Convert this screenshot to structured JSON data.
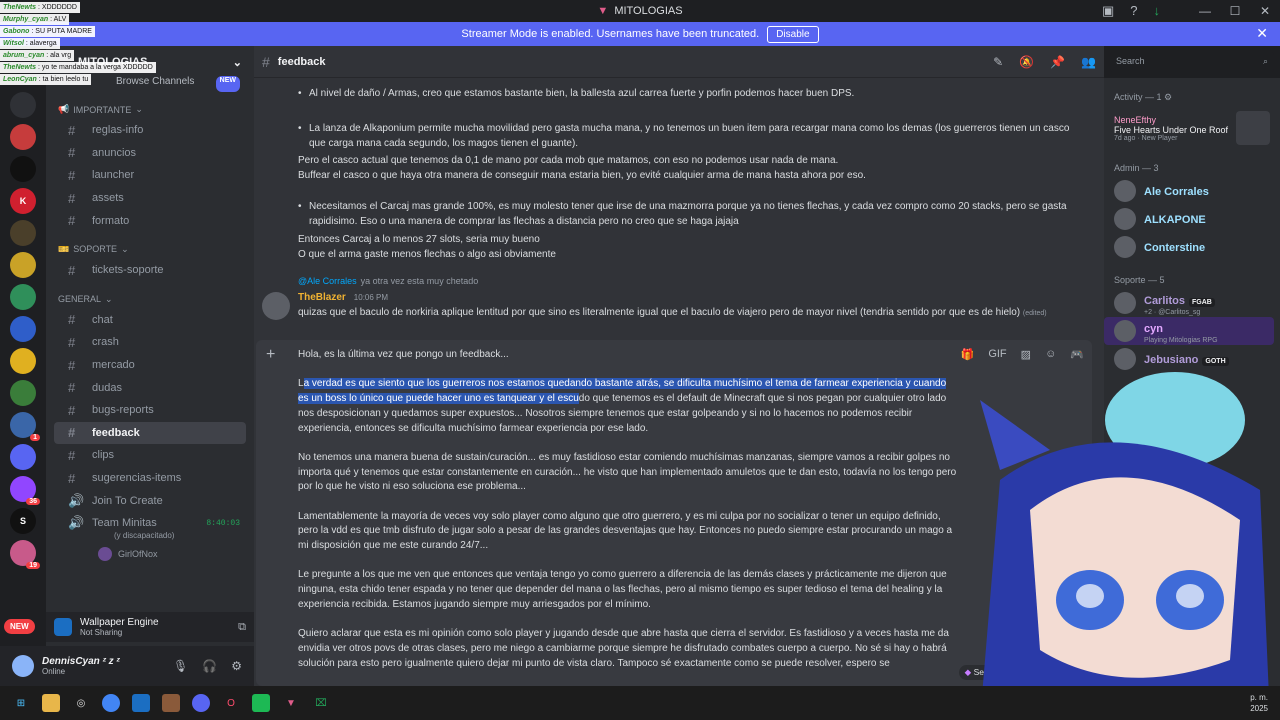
{
  "window": {
    "title": "MITOLOGIAS"
  },
  "banner": {
    "text": "Streamer Mode is enabled. Usernames have been truncated.",
    "button": "Disable"
  },
  "stream_chat": [
    {
      "user": "TheNewts",
      "msg": "XDDDDDD"
    },
    {
      "user": "Murphy_cyan",
      "msg": "ALV"
    },
    {
      "user": "Gabono",
      "msg": "SU PUTA MADRE"
    },
    {
      "user": "Witsol",
      "msg": "alavergа"
    },
    {
      "user": "abrum_cyan",
      "msg": "ala vrg"
    },
    {
      "user": "TheNewts",
      "msg": "yo te mandaba a la verga XDDDDD"
    },
    {
      "user": "LeonCyan",
      "msg": "ta bien leelo tu"
    }
  ],
  "server": {
    "name": "MITOLOGIAS",
    "browse": "Browse Channels",
    "browse_badge": "NEW"
  },
  "categories": {
    "importante": {
      "emoji": "📢",
      "label": "IMPORTANTE"
    },
    "soporte": {
      "emoji": "🎫",
      "label": "SOPORTE"
    },
    "general": {
      "label": "GENERAL"
    }
  },
  "channels_importante": [
    "reglas-info",
    "anuncios",
    "launcher",
    "assets",
    "formato"
  ],
  "channels_soporte": [
    "tickets-soporte"
  ],
  "channels_general": [
    "chat",
    "crash",
    "mercado",
    "dudas",
    "bugs-reports",
    "feedback",
    "clips",
    "sugerencias-items",
    "Join To Create"
  ],
  "voice": {
    "name": "Team Minitas",
    "time": "8:40:03",
    "sub": "(y discapacitado)",
    "user": "GirlOfNox"
  },
  "rail_new": "NEW",
  "rail_badges": [
    "1",
    "36",
    "19"
  ],
  "now_playing": {
    "title": "Wallpaper Engine",
    "sub": "Not Sharing"
  },
  "user": {
    "name": "DennisCyan ᶻ z ᶻ",
    "status": "Online"
  },
  "header": {
    "channel": "feedback",
    "search_placeholder": "Search"
  },
  "messages": {
    "b1": "Al nivel de daño / Armas, creo que estamos bastante bien, la ballesta azul carrea fuerte y porfin podemos hacer buen DPS.",
    "b2": "La lanza de Alkaponium permite mucha movilidad pero gasta mucha mana, y no tenemos un buen item para recargar mana como los demas (los guerreros tienen un casco que carga mana cada segundo, los magos tienen el guante).",
    "p1": "Pero el casco actual que tenemos da 0,1 de mano por cada mob que matamos, con eso no podemos usar nada de mana.",
    "p2": "Buffear el casco o que haya otra manera de conseguir mana estaria bien, yo evité cualquier arma de mana hasta ahora por eso.",
    "b3": "Necesitamos el Carcaj mas grande 100%, es muy molesto tener que irse de una mazmorra porque ya no tienes flechas, y cada vez compro como 20 stacks, pero se gasta rapidisimo. Eso o una manera de comprar las flechas a distancia pero no creo que se haga jajaja",
    "p3": "Entonces Carcaj a lo menos 27 slots, seria muy bueno",
    "p4": "O que el arma gaste menos flechas o algo asi obviamente",
    "reply_to": "@Ale Corrales",
    "reply_text": "ya otra vez esta muy chetado",
    "author": "TheBlazer",
    "time": "10:06 PM",
    "reply_body": "quizas que el baculo de norkiria aplique lentitud por que sino es literalmente igual que el baculo de viajero pero de mayor nivel (tendria sentido por que es de hielo)",
    "edited": "(edited)"
  },
  "composer": {
    "l0": "Hola, es la última vez que pongo un feedback...",
    "l1_first": "L",
    "l1_hl": "a verdad es que siento que los guerreros nos estamos quedando bastante atrás, se dificulta muchísimo el tema de farmear experiencia y cuando es un boss lo único que puede hacer uno es tanquear y el escu",
    "l1_rest": "do que tenemos es el default de Minecraft que si nos pegan por cualquier otro lado nos desposicionan y quedamos super expuestos... Nosotros siempre tenemos que estar golpeando y si no lo hacemos no podemos recibir experiencia, entonces se dificulta muchísimo farmear experiencia por ese lado.",
    "l2": "No tenemos una manera buena de sustain/curación... es muy fastidioso estar comiendo muchísimas manzanas, siempre vamos a recibir golpes no importa qué y tenemos que estar constantemente en curación... he visto que han implementado amuletos que te dan esto, todavía no los tengo pero por lo que he visto ni eso soluciona ese problema...",
    "l3": "Lamentablemente la mayoría de veces voy solo player como alguno que otro guerrero, y es mi culpa por no socializar o tener un equipo definido, pero la vdd es que tmb disfruto de jugar solo a pesar de las grandes desventajas que hay. Entonces no puedo siempre estar procurando un mago a mi disposición que me este curando 24/7...",
    "l4": "Le pregunte a los que me ven que entonces que ventaja tengo yo como guerrero a diferencia de las demás clases y prácticamente me dijeron que ninguna, esta chido tener espada y no tener que depender del mana o las flechas, pero al mismo tiempo es super tedioso el tema del healing y la experiencia recibida. Estamos jugando siempre muy arriesgados por el mínimo.",
    "l5": "Quiero aclarar que esta es mi opinión como solo player y jugando desde que abre hasta que cierra el servidor. Es fastidioso y a veces hasta me da envidia ver otros povs de otras clases, pero me niego a cambiarme porque siempre he disfrutado combates cuerpo a cuerpo. No sé si hay o habrá solución para esto pero igualmente quiero dejar mi punto de vista claro. Tampoco sé exactamente como se puede resolver, espero se",
    "longer": "Send longer messages with"
  },
  "members": {
    "activity_head": "Activity — 1",
    "activity_user": "NeneEfthy",
    "activity_title": "Five Hearts Under One Roof",
    "activity_meta": "7d ago",
    "activity_new": "New Player",
    "admin_head": "Admin — 3",
    "admins": [
      {
        "name": "Ale Corrales",
        "color": "#9ee0ff"
      },
      {
        "name": "ALKAPONE",
        "color": "#9ee0ff"
      },
      {
        "name": "Conterstine",
        "color": "#9ee0ff"
      }
    ],
    "soporte_head": "Soporte — 5",
    "soporte": [
      {
        "name": "Carlitos",
        "tag": "FGAB",
        "sub": "+2 · @Carlitos_sg",
        "color": "#b19cd9"
      },
      {
        "name": "cyn",
        "tag": "",
        "sub": "Playing Mitologias RPG",
        "color": "#e3a8ff"
      },
      {
        "name": "Jebusiano",
        "tag": "GOTH",
        "sub": "",
        "color": "#b19cd9"
      }
    ]
  },
  "clock": {
    "l1": "p. m.",
    "l2": "2025"
  }
}
